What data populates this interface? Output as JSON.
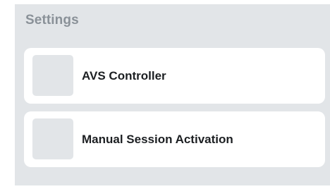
{
  "settings": {
    "title": "Settings",
    "items": [
      {
        "label": "AVS Controller"
      },
      {
        "label": "Manual Session Activation"
      }
    ]
  }
}
